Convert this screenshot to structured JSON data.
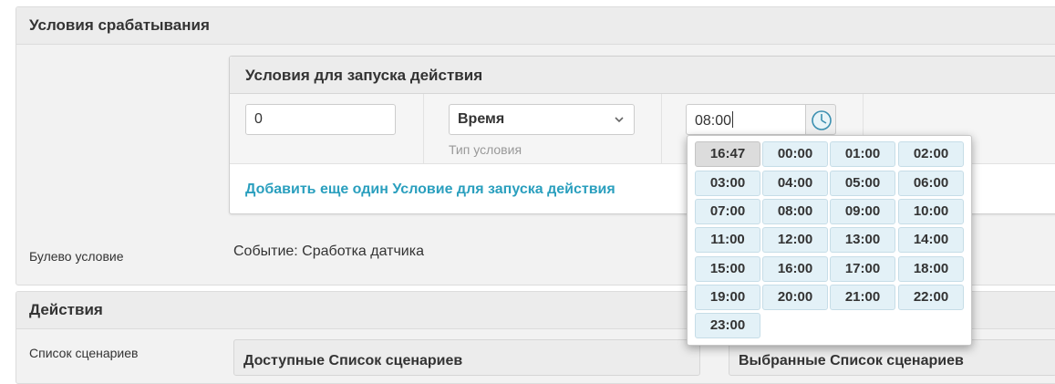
{
  "trigger_panel": {
    "title": "Условия срабатывания",
    "conditions_box": {
      "title": "Условия для запуска действия",
      "value_input": "0",
      "condition_type_select": "Время",
      "condition_type_hint": "Тип условия",
      "time_input": "08:00",
      "add_link": "Добавить еще один Условие для запуска действия"
    },
    "bool_condition": {
      "label": "Булево условие",
      "value": "Событие: Сработка датчика"
    }
  },
  "actions_panel": {
    "title": "Действия",
    "scenarios_label": "Список сценариев",
    "available_header": "Доступные Список сценариев",
    "selected_header": "Выбранные Список сценариев"
  },
  "time_picker": {
    "current": "16:47",
    "slots": [
      "00:00",
      "01:00",
      "02:00",
      "03:00",
      "04:00",
      "05:00",
      "06:00",
      "07:00",
      "08:00",
      "09:00",
      "10:00",
      "11:00",
      "12:00",
      "13:00",
      "14:00",
      "15:00",
      "16:00",
      "17:00",
      "18:00",
      "19:00",
      "20:00",
      "21:00",
      "22:00",
      "23:00"
    ]
  },
  "icons": {
    "clock": "clock-icon",
    "select_arrow": "chevron-down-icon"
  },
  "colors": {
    "link": "#2a9fbe",
    "slot_bg": "#e3f1f7",
    "current_slot_bg": "#dcdcdc"
  }
}
